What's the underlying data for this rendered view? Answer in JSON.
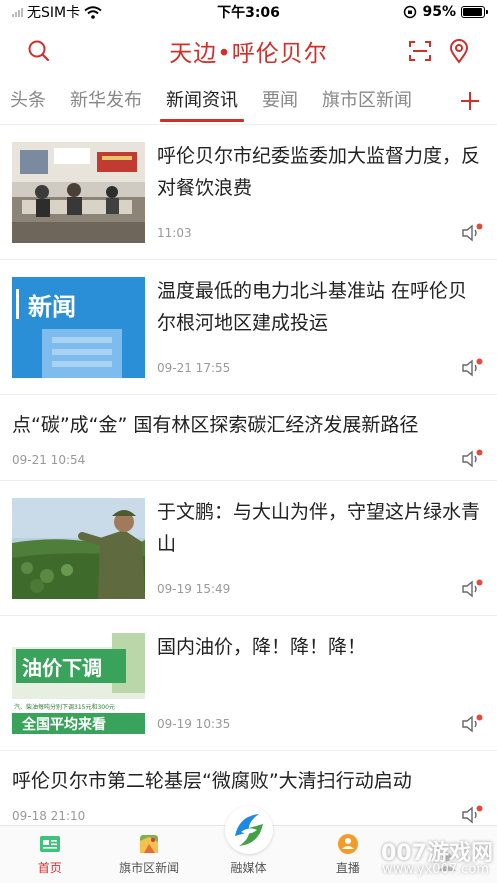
{
  "status_bar": {
    "carrier": "无SIM卡",
    "time": "下午3:06",
    "battery": "95%",
    "battery_level": 0.95
  },
  "header": {
    "title": "天边•呼伦贝尔",
    "icons": [
      "search-icon",
      "scan-icon",
      "location-icon"
    ],
    "accent_color": "#d0302b"
  },
  "tabs": [
    {
      "label": "头条",
      "active": false
    },
    {
      "label": "新华发布",
      "active": false
    },
    {
      "label": "新闻资讯",
      "active": true
    },
    {
      "label": "要闻",
      "active": false
    },
    {
      "label": "旗市区新闻",
      "active": false
    }
  ],
  "feed": {
    "items": [
      {
        "title": "呼伦贝尔市纪委监委加大监督力度，反对餐饮浪费",
        "time": "11:03",
        "thumb": "meeting-room-photo"
      },
      {
        "title": "温度最低的电力北斗基准站 在呼伦贝尔根河地区建成投运",
        "time": "09-21 17:55",
        "thumb": "news-placeholder",
        "thumb_text": "新闻"
      },
      {
        "title": "点“碳”成“金” 国有林区探索碳汇经济发展新路径",
        "time": "09-21 10:54"
      },
      {
        "title": "于文鹏：与大山为伴，守望这片绿水青山",
        "time": "09-19 15:49",
        "thumb": "forest-ranger-photo"
      },
      {
        "title": "国内油价，降！降！降！",
        "time": "09-19 10:35",
        "thumb": "oil-price-banner",
        "thumb_text": "油价下调",
        "thumb_subtext": "汽、柴油每吨分别下调315元和300元",
        "thumb_bottom": "全国平均来看"
      },
      {
        "title": "呼伦贝尔市第二轮基层“微腐败”大清扫行动启动",
        "time": "09-18 21:10"
      }
    ]
  },
  "bottom_nav": {
    "items": [
      {
        "label": "首页",
        "icon": "home-icon",
        "active": true
      },
      {
        "label": "旗市区新闻",
        "icon": "map-icon",
        "active": false
      },
      {
        "label": "融媒体",
        "icon": "media-logo-icon",
        "active": false
      },
      {
        "label": "直播",
        "icon": "live-icon",
        "active": false
      },
      {
        "label": "",
        "icon": "user-icon",
        "active": false
      }
    ]
  },
  "watermark": {
    "text": "007游戏网",
    "sub": "www.yx007.com"
  }
}
